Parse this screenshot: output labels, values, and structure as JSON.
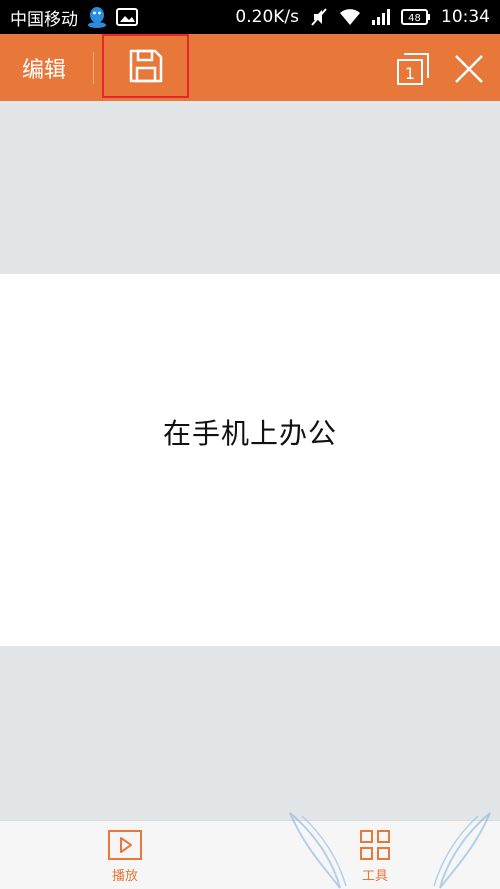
{
  "status_bar": {
    "carrier": "中国移动",
    "speed": "0.20K/s",
    "battery": "48",
    "time": "10:34",
    "icons": [
      "qq-icon",
      "image-icon",
      "mute-icon",
      "wifi-icon",
      "signal-icon",
      "battery-icon"
    ]
  },
  "toolbar": {
    "edit_label": "编辑",
    "page_count": "1",
    "icons": [
      "save-icon",
      "pages-icon",
      "close-icon"
    ]
  },
  "slide": {
    "text": "在手机上办公"
  },
  "bottom_bar": {
    "play_label": "播放",
    "tools_label": "工具"
  },
  "colors": {
    "accent": "#e8783a",
    "highlight_box": "#e6262b",
    "canvas_bg": "#e3e6e9"
  }
}
